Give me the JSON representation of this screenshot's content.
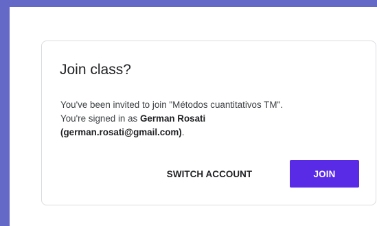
{
  "dialog": {
    "title": "Join class?",
    "invite_prefix": "You've been invited to join \"",
    "class_name": "Métodos cuantitativos TM",
    "invite_suffix": "\".",
    "signed_in_prefix": "You're signed in as ",
    "user_name": "German Rosati",
    "user_email": "(german.rosati@gmail.com)",
    "signed_in_suffix": ".",
    "switch_account_label": "SWITCH ACCOUNT",
    "join_label": "JOIN"
  },
  "colors": {
    "page_border": "#6468c6",
    "primary_button": "#5a2be6"
  }
}
